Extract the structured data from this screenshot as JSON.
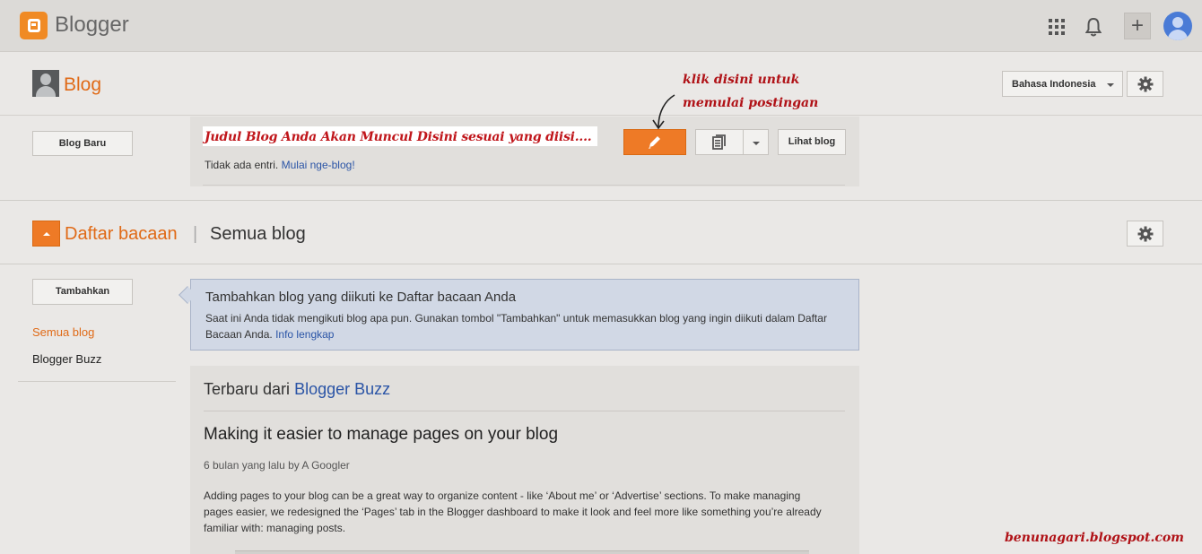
{
  "app": {
    "brand": "Blogger",
    "accent_color": "#ee7a26"
  },
  "topbar": {
    "icons": [
      "apps-grid-icon",
      "bell-icon",
      "plus-icon",
      "account-avatar-icon"
    ],
    "plus_label": "+"
  },
  "blog_header": {
    "title": "Blog",
    "language_select": "Bahasa Indonesia"
  },
  "blog_row": {
    "new_blog_button": "Blog Baru",
    "blog_name": "Judul Blog Anda Akan Muncul Disini sesuai yang diisi....",
    "no_entries": "Tidak ada entri.",
    "start_link": "Mulai nge-blog!",
    "view_blog_button": "Lihat blog"
  },
  "annotation": {
    "line1": "klik disini untuk",
    "line2": "memulai postingan"
  },
  "reading_list": {
    "title": "Daftar bacaan",
    "separator": "|",
    "subtitle": "Semua blog",
    "add_button": "Tambahkan",
    "side_items": [
      {
        "label": "Semua blog",
        "active": true
      },
      {
        "label": "Blogger Buzz",
        "active": false
      }
    ],
    "info": {
      "title": "Tambahkan blog yang diikuti ke Daftar bacaan Anda",
      "text": "Saat ini Anda tidak mengikuti blog apa pun. Gunakan tombol \"Tambahkan\" untuk memasukkan blog yang ingin diikuti dalam Daftar Bacaan Anda.",
      "link": "Info lengkap"
    },
    "buzz": {
      "heading_prefix": "Terbaru dari",
      "heading_link": "Blogger Buzz",
      "post_title": "Making it easier to manage pages on your blog",
      "post_meta": "6 bulan yang lalu by A Googler",
      "post_body": "Adding pages to your blog can be a great way to organize content - like ‘About me’ or ‘Advertise’ sections. To make managing pages easier, we redesigned the ‘Pages’ tab in the Blogger dashboard to make it look and feel more like something you’re already familiar with: managing posts."
    }
  },
  "watermark": "benunagari.blogspot.com"
}
